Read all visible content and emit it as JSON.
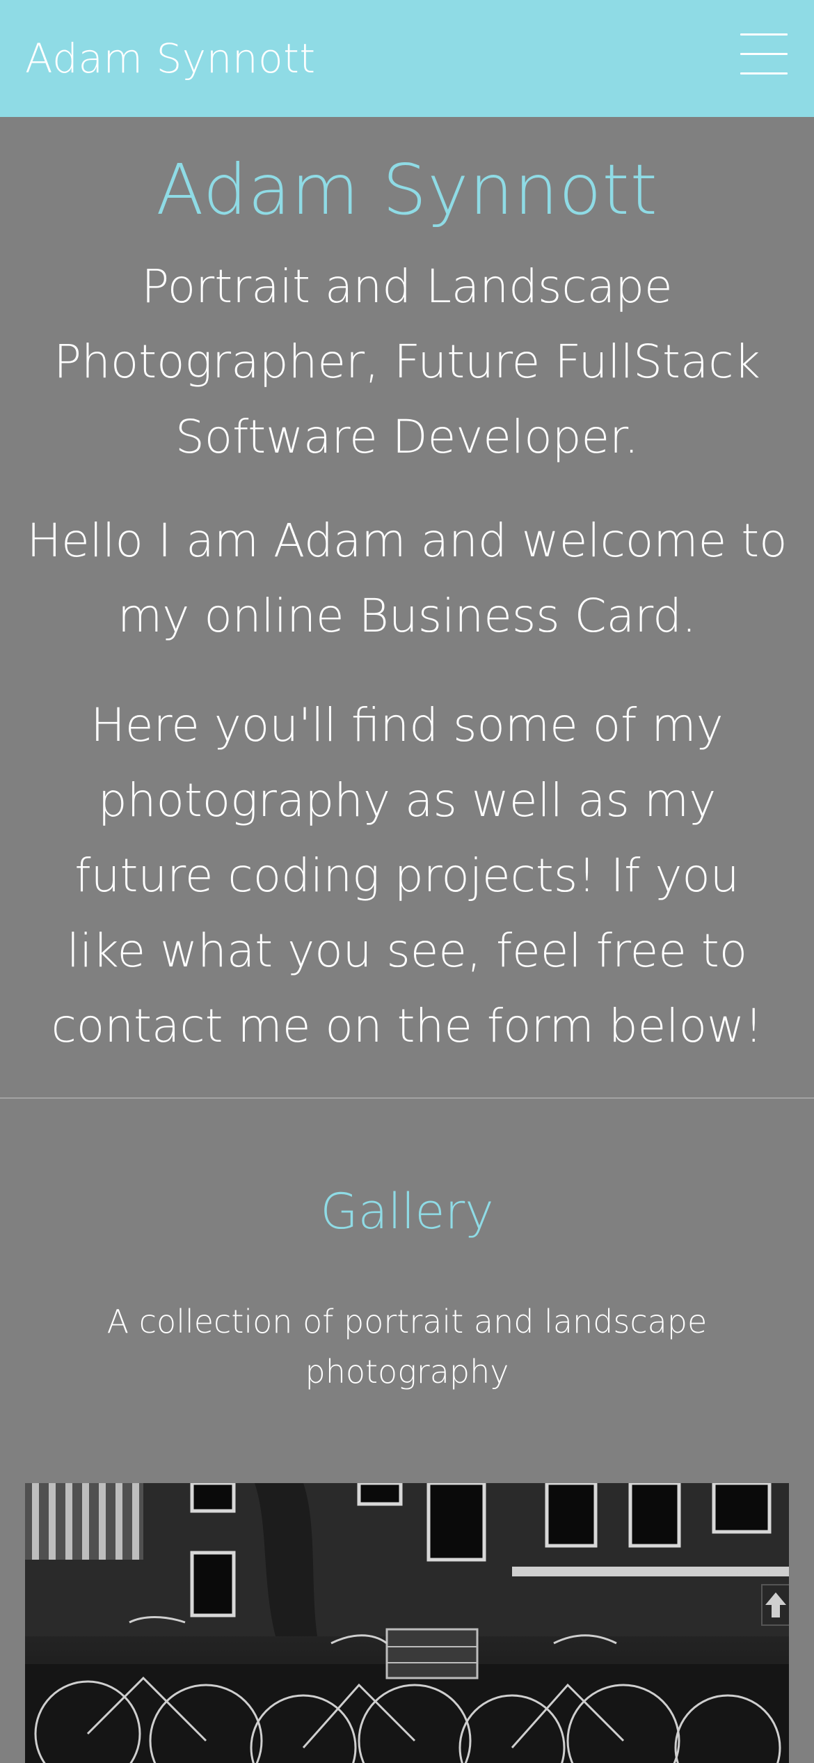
{
  "navbar": {
    "brand": "Adam Synnott",
    "menu_icon": "hamburger-menu-icon"
  },
  "hero": {
    "title": "Adam Synnott",
    "subtitle": "Portrait and Landscape Photographer, Future FullStack Software Developer.",
    "paragraphs": [
      "Hello I am Adam and welcome to my online Business Card.",
      "Here you'll find some of my photography as well as my future coding projects! If you like what you see, feel free to contact me on the form below!"
    ]
  },
  "gallery": {
    "title": "Gallery",
    "description": "A collection of portrait and landscape photography",
    "photo_overlay_icon": "arrow-up-icon"
  },
  "colors": {
    "accent": "#8fdbe5",
    "background": "#808080",
    "text": "#ffffff"
  }
}
